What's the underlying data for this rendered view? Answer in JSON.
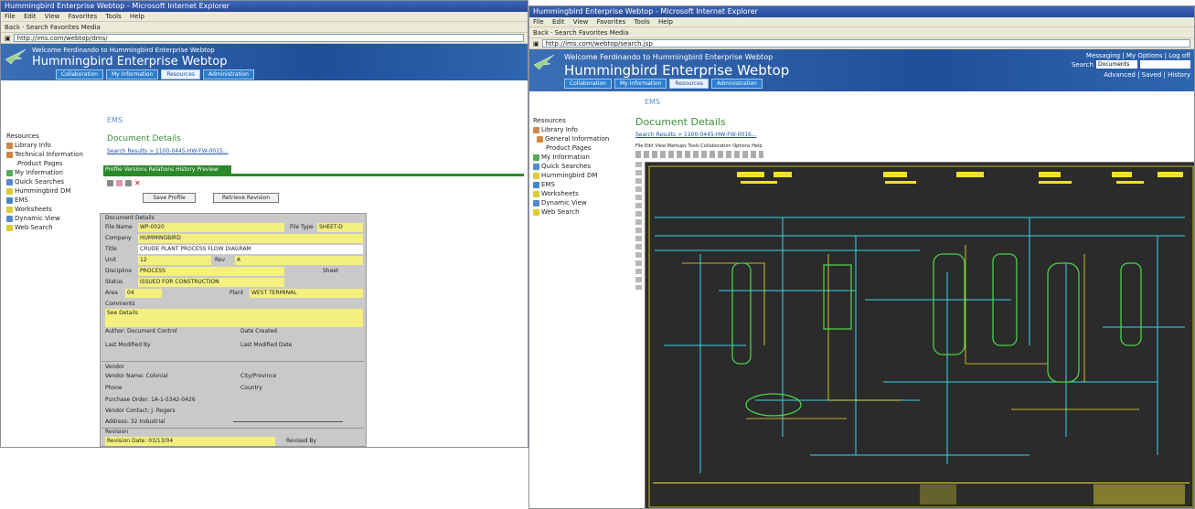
{
  "left_window": {
    "title": "Hummingbird Enterprise Webtop - Microsoft Internet Explorer",
    "menu": [
      "File",
      "Edit",
      "View",
      "Favorites",
      "Tools",
      "Help"
    ],
    "toolbar_text": "Back  ·  Search  Favorites  Media",
    "address": "http://ims.com/webtop/dms/",
    "banner_welcome": "Welcome Ferdinando to Hummingbird Enterprise Webtop",
    "banner_brand": "Hummingbird Enterprise Webtop",
    "tabs": [
      "Collaboration",
      "My Information",
      "Resources",
      "Administration"
    ],
    "ems_label": "EMS",
    "section_title": "Document Details",
    "breadcrumb": "Search Results > 1100-0445-HW-FW-0015...",
    "sidebar": [
      "Resources",
      "Library Info",
      "Technical Information",
      "Product Pages",
      "My Information",
      "Quick Searches",
      "Hummingbird DM",
      "EMS",
      "Worksheets",
      "Dynamic View",
      "Web Search"
    ],
    "doc_tabs": "Profile  Versions  Relations  History  Preview",
    "buttons": [
      "Save Profile",
      "Retrieve Revision"
    ],
    "form": {
      "panel_title": "Document Details",
      "rows": [
        {
          "label": "File Name",
          "value": "WP-0020",
          "extra_label": "File Type",
          "extra_value": "SHEET-D"
        },
        {
          "label": "Company",
          "value": "HUMMINGBIRD"
        },
        {
          "label": "Title",
          "value": "CRUDE PLANT PROCESS FLOW DIAGRAM"
        },
        {
          "label": "Unit",
          "value": "12",
          "extra_label": "Rev",
          "extra_value": "A"
        },
        {
          "label": "Discipline",
          "value": "PROCESS",
          "extra_label": "Sheet",
          "extra_value": ""
        },
        {
          "label": "Status",
          "value": "ISSUED FOR CONSTRUCTION"
        },
        {
          "label": "Area",
          "value": "04",
          "extra_label": "Plant",
          "extra_value": "WEST TERMINAL"
        }
      ],
      "comments_label": "Comments",
      "comments_value": "See Details",
      "info_left": [
        "Author: Document Control",
        "Last Modified By"
      ],
      "info_right": [
        "Date Created",
        "Last Modified Date"
      ],
      "vendor_title": "Vendor",
      "vendor_rows": [
        "Vendor Name: Colonial",
        "Phone",
        "Purchase Order: 1A-1-5342-0426",
        "Vendor Contact: J. Rogers",
        "Address: 32 Industrial"
      ],
      "vendor_right": [
        "City/Province",
        "Country"
      ],
      "rev_title": "Revision",
      "rev_row": "Revision Date: 03/13/04",
      "rev_right": "Revised By"
    }
  },
  "right_window": {
    "title": "Hummingbird Enterprise Webtop - Microsoft Internet Explorer",
    "menu": [
      "File",
      "Edit",
      "View",
      "Favorites",
      "Tools",
      "Help"
    ],
    "toolbar_text": "Back  ·  Search  Favorites  Media",
    "address": "http://ims.com/webtop/search.jsp",
    "banner_welcome": "Welcome Ferdinando to Hummingbird Enterprise Webtop",
    "banner_brand": "Hummingbird Enterprise Webtop",
    "tabs": [
      "Collaboration",
      "My Information",
      "Resources",
      "Administration"
    ],
    "top_links": "Messaging | My Options | Log off",
    "search_label": "Search",
    "search_select": "Documents",
    "search_links": "Advanced | Saved | History",
    "ems_label": "EMS",
    "section_title": "Document Details",
    "breadcrumb": "Search Results > 1100-0445-HW-FW-0016...",
    "viewer_menu": "File  Edit  View  Markups  Tools  Collaboration  Options  Help",
    "sidebar": [
      "Resources",
      "Library Info",
      "General Information",
      "Product Pages",
      "My Information",
      "Quick Searches",
      "Hummingbird DM",
      "EMS",
      "Worksheets",
      "Dynamic View",
      "Web Search"
    ]
  },
  "colors": {
    "banner": "#1f4f9a",
    "tab": "#2d7fd0",
    "field_yellow": "#f4f080",
    "drawing_bg": "#2b2b2b",
    "pipe_cyan": "#35d4e8",
    "pipe_yellow": "#f0e030",
    "vessel_green": "#4ad04a",
    "accent_green": "#3b8f3b"
  }
}
